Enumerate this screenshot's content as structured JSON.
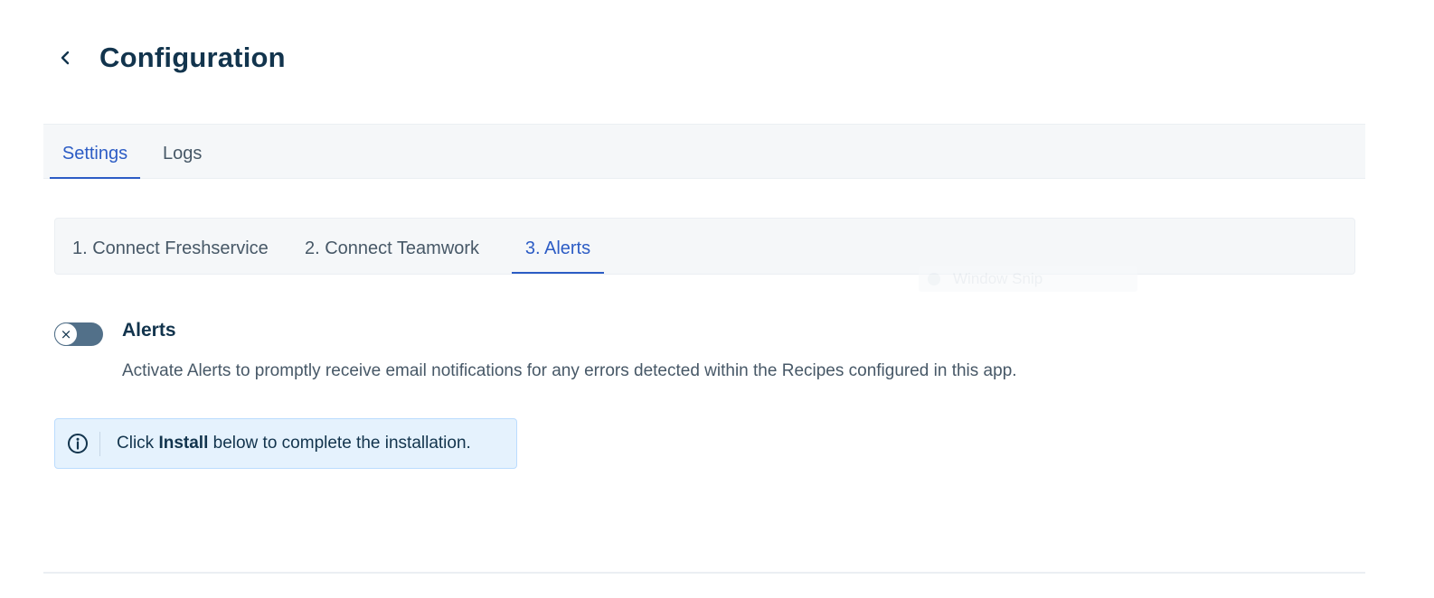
{
  "header": {
    "title": "Configuration",
    "back_icon": "chevron-left-icon"
  },
  "main_tabs": [
    {
      "label": "Settings",
      "active": true
    },
    {
      "label": "Logs",
      "active": false
    }
  ],
  "step_tabs": [
    {
      "label": "1. Connect Freshservice",
      "active": false
    },
    {
      "label": "2. Connect Teamwork",
      "active": false
    },
    {
      "label": "3. Alerts",
      "active": true
    }
  ],
  "overlay": {
    "text": "Window Snip"
  },
  "alerts": {
    "toggle_on": false,
    "toggle_icon": "close-icon",
    "toggle_glyph": "×",
    "title": "Alerts",
    "description": "Activate Alerts to promptly receive email notifications for any errors detected within the Recipes configured in this app."
  },
  "info": {
    "icon": "info-icon",
    "text_before": "Click ",
    "text_bold": "Install",
    "text_after": " below to complete the installation."
  },
  "colors": {
    "accent": "#2c5cc5",
    "text_primary": "#12344d",
    "text_secondary": "#475867",
    "toggle_off": "#527089",
    "info_bg": "#e5f2fd"
  }
}
